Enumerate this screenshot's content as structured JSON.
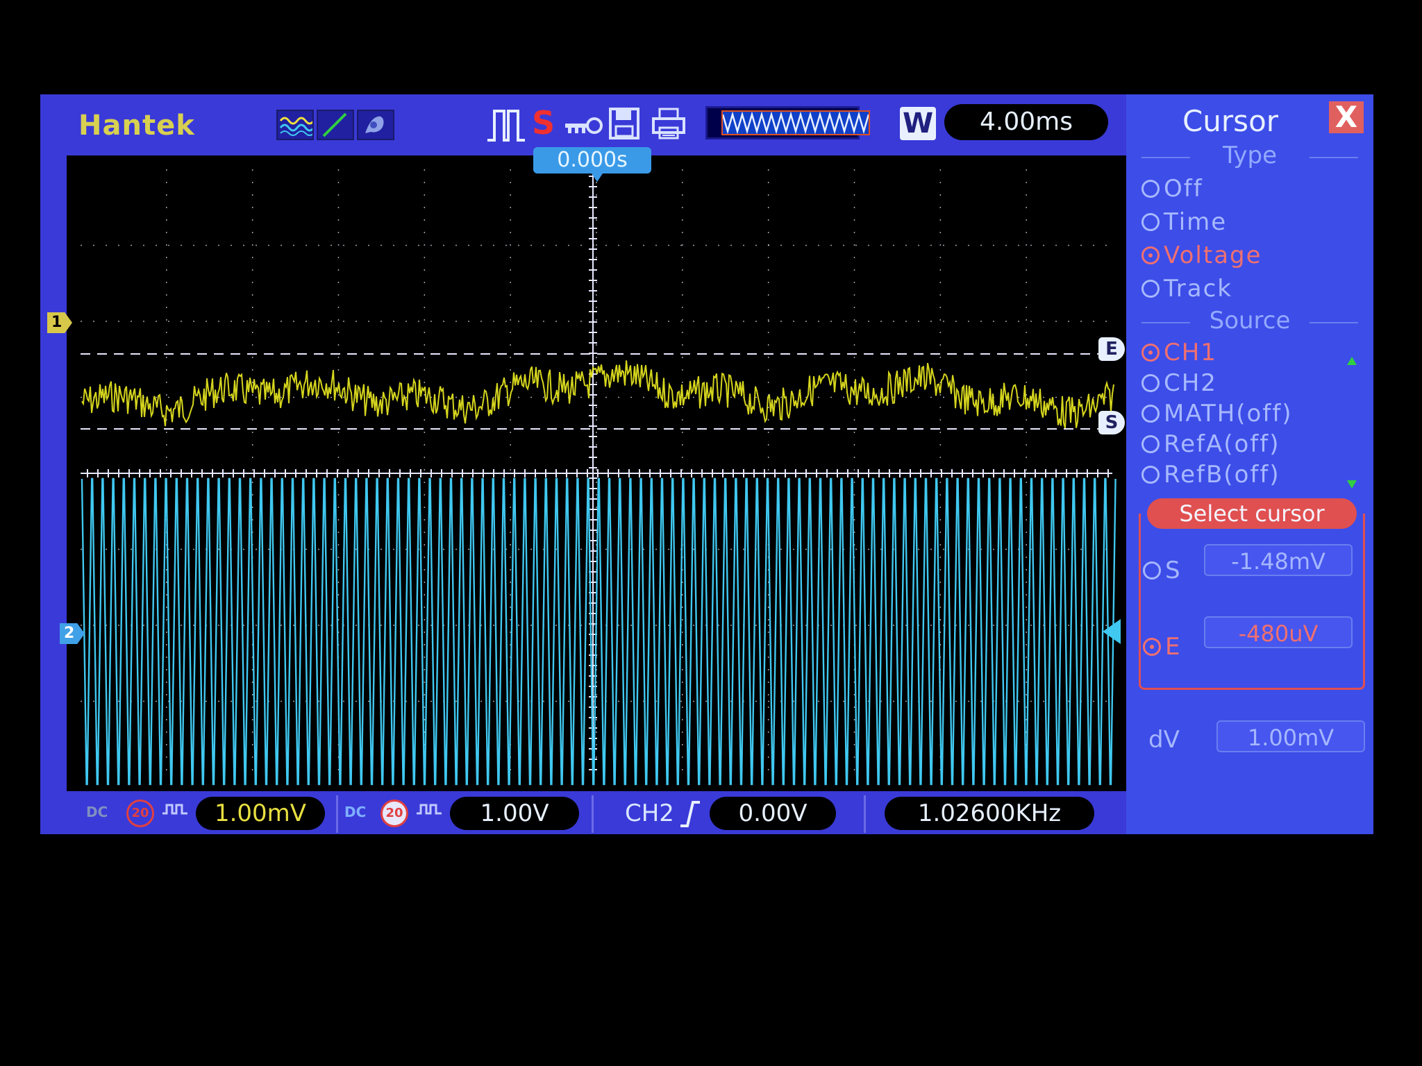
{
  "toolbar": {
    "brand": "Hantek",
    "icons": [
      "wave-mode-icon",
      "line-icon",
      "persist-icon",
      "pulse-icon",
      "stop-icon",
      "key-icon",
      "save-icon",
      "print-icon"
    ],
    "stop_symbol": "S",
    "window_badge": "W",
    "timebase": "4.00ms"
  },
  "plot": {
    "trigger_time": "0.000s",
    "ch1_marker": "1",
    "ch2_marker": "2",
    "cursor_end_label": "E",
    "cursor_start_label": "S",
    "colors": {
      "ch1": "#e0e020",
      "ch2": "#40c8f0",
      "grid": "#e8e8ff"
    }
  },
  "bottom": {
    "ch1_coupling": "DC",
    "ch1_bw_limit": "20",
    "ch1_scale": "1.00mV",
    "ch2_coupling": "DC",
    "ch2_bw_limit": "20",
    "ch2_scale": "1.00V",
    "trigger_source": "CH2",
    "trigger_level": "0.00V",
    "frequency": "1.02600KHz"
  },
  "panel": {
    "title": "Cursor",
    "close_symbol": "X",
    "type_header": "Type",
    "type_options": [
      "Off",
      "Time",
      "Voltage",
      "Track"
    ],
    "source_header": "Source",
    "source_options": [
      "CH1",
      "CH2",
      "MATH(off)",
      "RefA(off)",
      "RefB(off)"
    ],
    "select_cursor_label": "Select cursor",
    "s_label": "S",
    "s_value": "-1.48mV",
    "e_label": "E",
    "e_value": "-480uV",
    "dv_label": "dV",
    "dv_value": "1.00mV"
  }
}
